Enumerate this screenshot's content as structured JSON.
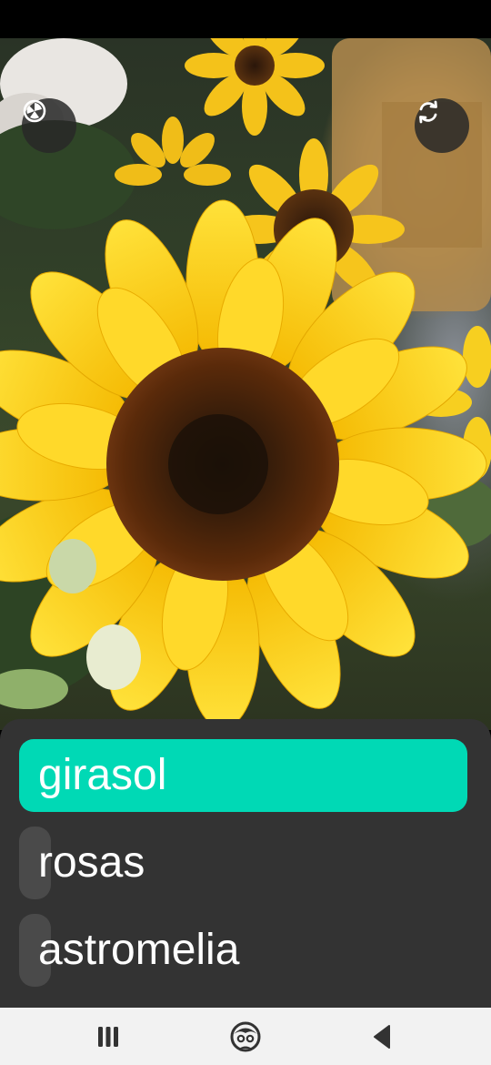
{
  "colors": {
    "accent": "#00d9b5",
    "panel": "#333333",
    "bar_idle": "#4a4a4a",
    "nav_bg": "#f2f2f2"
  },
  "camera": {
    "left_button_icon": "gallery-lens-icon",
    "right_button_icon": "switch-camera-icon"
  },
  "results": [
    {
      "label": "girasol",
      "confidence": 1.0
    },
    {
      "label": "rosas",
      "confidence": 0.07
    },
    {
      "label": "astromelia",
      "confidence": 0.07
    }
  ],
  "nav": {
    "recent_icon": "recent-apps-icon",
    "home_icon": "home-assistant-icon",
    "back_icon": "back-icon"
  }
}
